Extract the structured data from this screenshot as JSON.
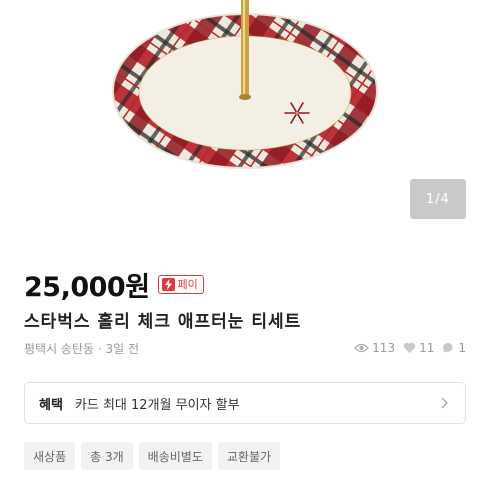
{
  "photo": {
    "alt_icons": [
      "cake-stand-plate",
      "snowflake-icon"
    ]
  },
  "gallery": {
    "counter": "1/4"
  },
  "listing": {
    "price": "25,000원",
    "pay_badge": "페이",
    "title": "스타벅스 홀리 체크 애프터눈 티세트",
    "location": "평택시 송탄동 · 3일 전",
    "stats": {
      "views": "113",
      "likes": "11",
      "chats": "1"
    }
  },
  "benefit": {
    "label": "혜택",
    "text": "카드 최대 12개월 무이자 할부"
  },
  "tags": [
    "새상품",
    "총 3개",
    "배송비별도",
    "교환불가"
  ],
  "colors": {
    "accent": "#e03a3a",
    "plaid_red": "#b7232c",
    "plate_cream": "#f3efe4",
    "gold": "#c9a24a"
  }
}
